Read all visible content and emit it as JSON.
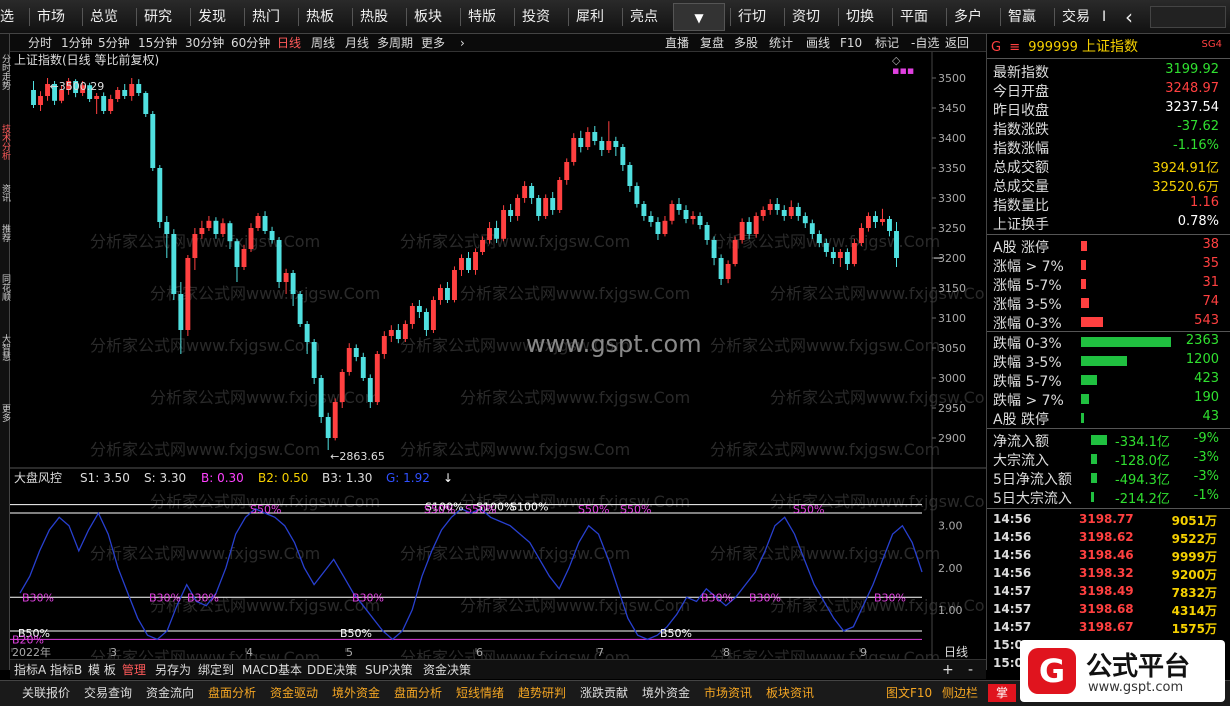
{
  "topmenu": {
    "items": [
      "选",
      "市场",
      "总览",
      "研究",
      "发现",
      "热门",
      "热板",
      "热股",
      "板块",
      "特版",
      "投资",
      "犀利",
      "亮点",
      "行切",
      "资切",
      "切换",
      "平面",
      "多户",
      "智赢",
      "交易",
      "I"
    ],
    "dropdown": "▼",
    "back": "‹"
  },
  "left_strip": [
    "分时走势",
    "技术分析",
    "资讯",
    "推荐",
    "同花顺",
    "大智慧",
    "更多"
  ],
  "subbar": {
    "periods": [
      "分时",
      "1分钟",
      "5分钟",
      "15分钟",
      "30分钟",
      "60分钟",
      "日线",
      "周线",
      "月线",
      "多周期",
      "更多"
    ],
    "active_index": 6,
    "tools": [
      "直播",
      "复盘",
      "多股",
      "统计",
      "画线",
      "F10",
      "标记",
      "-自选",
      "返回"
    ]
  },
  "chart": {
    "title": "上证指数(日线 等比前复权)",
    "watermark": "www.gspt.com",
    "bg_watermark": "分析家公式网www.fxjgsw.Com",
    "price_axis": [
      "3500",
      "3450",
      "3400",
      "3350",
      "3300",
      "3250",
      "3200",
      "3150",
      "3100",
      "3050",
      "3000",
      "2950",
      "2900"
    ],
    "annot_high": "3500.29",
    "annot_low": "2863.65",
    "indicator": {
      "name": "大盘风控",
      "params": [
        {
          "label": "S1: 3.50",
          "color": "#dddddd"
        },
        {
          "label": "S: 3.30",
          "color": "#dddddd"
        },
        {
          "label": "B: 0.30",
          "color": "#ff40ff"
        },
        {
          "label": "B2: 0.50",
          "color": "#f5d000"
        },
        {
          "label": "B3: 1.30",
          "color": "#dddddd"
        },
        {
          "label": "G: 1.92",
          "color": "#3050ff"
        }
      ],
      "axis": [
        "3.00",
        "2.00",
        "1.00"
      ],
      "marks_white": [
        "S100%",
        "S100%",
        "S100%",
        "B50%",
        "B50%",
        "B50%"
      ],
      "marks_magenta": [
        "S50%",
        "S50%",
        "S50%",
        "S50%",
        "S50%",
        "S50%",
        "B30%",
        "B30%",
        "B30%",
        "B30%",
        "B30%",
        "B30%",
        "B30%",
        "B20%"
      ]
    },
    "months": [
      "2022年",
      "3",
      "4",
      "5",
      "6",
      "7",
      "8",
      "9"
    ],
    "period_label": "日线",
    "zoom_in": "+",
    "zoom_out": "-"
  },
  "chart_data": {
    "type": "candlestick",
    "title": "上证指数(日线 等比前复权)",
    "ylim": [
      2880,
      3520
    ],
    "candles": [
      [
        3480,
        3455,
        3495,
        3450
      ],
      [
        3455,
        3470,
        3478,
        3445
      ],
      [
        3470,
        3490,
        3500,
        3462
      ],
      [
        3490,
        3462,
        3495,
        3455
      ],
      [
        3462,
        3480,
        3488,
        3458
      ],
      [
        3480,
        3495,
        3500,
        3472
      ],
      [
        3495,
        3475,
        3498,
        3468
      ],
      [
        3475,
        3488,
        3495,
        3470
      ],
      [
        3488,
        3465,
        3492,
        3460
      ],
      [
        3465,
        3470,
        3475,
        3440
      ],
      [
        3470,
        3445,
        3476,
        3440
      ],
      [
        3445,
        3465,
        3472,
        3440
      ],
      [
        3465,
        3480,
        3485,
        3460
      ],
      [
        3480,
        3470,
        3490,
        3465
      ],
      [
        3470,
        3490,
        3500,
        3462
      ],
      [
        3490,
        3475,
        3498,
        3470
      ],
      [
        3475,
        3440,
        3478,
        3435
      ],
      [
        3440,
        3350,
        3445,
        3345
      ],
      [
        3350,
        3260,
        3355,
        3250
      ],
      [
        3260,
        3240,
        3270,
        3200
      ],
      [
        3240,
        3140,
        3248,
        3130
      ],
      [
        3140,
        3080,
        3160,
        3040
      ],
      [
        3080,
        3200,
        3205,
        3070
      ],
      [
        3200,
        3240,
        3250,
        3180
      ],
      [
        3240,
        3250,
        3262,
        3232
      ],
      [
        3250,
        3262,
        3270,
        3245
      ],
      [
        3262,
        3240,
        3268,
        3232
      ],
      [
        3240,
        3258,
        3266,
        3235
      ],
      [
        3258,
        3228,
        3262,
        3215
      ],
      [
        3228,
        3185,
        3232,
        3160
      ],
      [
        3185,
        3215,
        3222,
        3180
      ],
      [
        3215,
        3250,
        3258,
        3210
      ],
      [
        3250,
        3270,
        3275,
        3245
      ],
      [
        3270,
        3245,
        3278,
        3240
      ],
      [
        3245,
        3230,
        3252,
        3224
      ],
      [
        3230,
        3160,
        3235,
        3150
      ],
      [
        3160,
        3175,
        3182,
        3140
      ],
      [
        3175,
        3140,
        3180,
        3120
      ],
      [
        3140,
        3090,
        3145,
        3085
      ],
      [
        3090,
        3060,
        3095,
        3040
      ],
      [
        3060,
        3000,
        3065,
        2990
      ],
      [
        3000,
        2935,
        3005,
        2925
      ],
      [
        2935,
        2900,
        2942,
        2880
      ],
      [
        2900,
        2960,
        2966,
        2896
      ],
      [
        2960,
        3010,
        3015,
        2950
      ],
      [
        3010,
        3050,
        3058,
        3004
      ],
      [
        3050,
        3035,
        3056,
        3028
      ],
      [
        3035,
        3000,
        3042,
        2995
      ],
      [
        3000,
        2960,
        3006,
        2950
      ],
      [
        2960,
        3040,
        3045,
        2955
      ],
      [
        3040,
        3070,
        3078,
        3032
      ],
      [
        3070,
        3080,
        3088,
        3060
      ],
      [
        3080,
        3065,
        3090,
        3058
      ],
      [
        3065,
        3090,
        3096,
        3060
      ],
      [
        3090,
        3120,
        3125,
        3082
      ],
      [
        3120,
        3110,
        3130,
        3100
      ],
      [
        3110,
        3080,
        3116,
        3070
      ],
      [
        3080,
        3130,
        3136,
        3075
      ],
      [
        3130,
        3150,
        3156,
        3122
      ],
      [
        3150,
        3130,
        3160,
        3125
      ],
      [
        3130,
        3180,
        3186,
        3126
      ],
      [
        3180,
        3200,
        3206,
        3170
      ],
      [
        3200,
        3180,
        3210,
        3175
      ],
      [
        3180,
        3210,
        3216,
        3172
      ],
      [
        3210,
        3230,
        3236,
        3205
      ],
      [
        3230,
        3250,
        3260,
        3224
      ],
      [
        3250,
        3232,
        3262,
        3225
      ],
      [
        3232,
        3280,
        3288,
        3228
      ],
      [
        3280,
        3270,
        3290,
        3260
      ],
      [
        3270,
        3300,
        3306,
        3262
      ],
      [
        3300,
        3320,
        3328,
        3292
      ],
      [
        3320,
        3300,
        3325,
        3290
      ],
      [
        3300,
        3270,
        3305,
        3262
      ],
      [
        3270,
        3300,
        3306,
        3265
      ],
      [
        3300,
        3280,
        3310,
        3272
      ],
      [
        3280,
        3330,
        3335,
        3275
      ],
      [
        3330,
        3360,
        3366,
        3322
      ],
      [
        3360,
        3400,
        3408,
        3354
      ],
      [
        3400,
        3385,
        3412,
        3376
      ],
      [
        3385,
        3410,
        3418,
        3380
      ],
      [
        3410,
        3395,
        3420,
        3388
      ],
      [
        3395,
        3380,
        3402,
        3370
      ],
      [
        3380,
        3395,
        3428,
        3375
      ],
      [
        3395,
        3385,
        3402,
        3370
      ],
      [
        3385,
        3355,
        3390,
        3345
      ],
      [
        3355,
        3320,
        3360,
        3310
      ],
      [
        3320,
        3290,
        3326,
        3284
      ],
      [
        3290,
        3270,
        3295,
        3262
      ],
      [
        3270,
        3260,
        3278,
        3252
      ],
      [
        3260,
        3240,
        3268,
        3230
      ],
      [
        3240,
        3262,
        3270,
        3236
      ],
      [
        3262,
        3290,
        3296,
        3256
      ],
      [
        3290,
        3280,
        3300,
        3272
      ],
      [
        3280,
        3265,
        3288,
        3258
      ],
      [
        3265,
        3270,
        3278,
        3256
      ],
      [
        3270,
        3255,
        3276,
        3248
      ],
      [
        3255,
        3230,
        3260,
        3222
      ],
      [
        3230,
        3200,
        3236,
        3188
      ],
      [
        3200,
        3165,
        3206,
        3155
      ],
      [
        3165,
        3190,
        3196,
        3158
      ],
      [
        3190,
        3230,
        3236,
        3186
      ],
      [
        3230,
        3260,
        3266,
        3224
      ],
      [
        3260,
        3240,
        3268,
        3232
      ],
      [
        3240,
        3270,
        3276,
        3234
      ],
      [
        3270,
        3280,
        3286,
        3262
      ],
      [
        3280,
        3290,
        3298,
        3272
      ],
      [
        3290,
        3280,
        3300,
        3272
      ],
      [
        3280,
        3270,
        3288,
        3262
      ],
      [
        3270,
        3285,
        3296,
        3265
      ],
      [
        3285,
        3270,
        3292,
        3262
      ],
      [
        3270,
        3258,
        3276,
        3250
      ],
      [
        3258,
        3240,
        3264,
        3232
      ],
      [
        3240,
        3225,
        3246,
        3218
      ],
      [
        3225,
        3210,
        3232,
        3202
      ],
      [
        3210,
        3200,
        3218,
        3190
      ],
      [
        3200,
        3210,
        3215,
        3185
      ],
      [
        3210,
        3190,
        3216,
        3180
      ],
      [
        3190,
        3225,
        3232,
        3186
      ],
      [
        3225,
        3250,
        3258,
        3220
      ],
      [
        3250,
        3270,
        3276,
        3244
      ],
      [
        3270,
        3260,
        3278,
        3250
      ],
      [
        3260,
        3265,
        3282,
        3254
      ],
      [
        3265,
        3245,
        3270,
        3236
      ],
      [
        3245,
        3200,
        3260,
        3185
      ]
    ]
  },
  "right_panel": {
    "code_prefix": "G",
    "menu_icon": "≡",
    "code": "999999",
    "name": "上证指数",
    "tag": "SG4",
    "quote": [
      {
        "label": "最新指数",
        "value": "3199.92",
        "cls": "dn"
      },
      {
        "label": "今日开盘",
        "value": "3248.97",
        "cls": "up"
      },
      {
        "label": "昨日收盘",
        "value": "3237.54",
        "cls": "wh"
      },
      {
        "label": "指数涨跌",
        "value": "-37.62",
        "cls": "dn"
      },
      {
        "label": "指数涨幅",
        "value": "-1.16%",
        "cls": "dn"
      },
      {
        "label": "总成交额",
        "value": "3924.91亿",
        "cls": "yl"
      },
      {
        "label": "总成交量",
        "value": "32520.6万",
        "cls": "yl"
      },
      {
        "label": "指数量比",
        "value": "1.16",
        "cls": "up"
      },
      {
        "label": "上证换手",
        "value": "0.78%",
        "cls": "wh"
      }
    ],
    "up_dist": [
      {
        "label": "A股 涨停",
        "value": "38",
        "bar": 6
      },
      {
        "label": "涨幅 > 7%",
        "value": "35",
        "bar": 5
      },
      {
        "label": "涨幅 5-7%",
        "value": "31",
        "bar": 5
      },
      {
        "label": "涨幅 3-5%",
        "value": "74",
        "bar": 8
      },
      {
        "label": "涨幅 0-3%",
        "value": "543",
        "bar": 22
      }
    ],
    "down_dist": [
      {
        "label": "跌幅 0-3%",
        "value": "2363",
        "bar": 90
      },
      {
        "label": "跌幅 3-5%",
        "value": "1200",
        "bar": 46
      },
      {
        "label": "跌幅 5-7%",
        "value": "423",
        "bar": 16
      },
      {
        "label": "跌幅 > 7%",
        "value": "190",
        "bar": 8
      },
      {
        "label": "A股 跌停",
        "value": "43",
        "bar": 3
      }
    ],
    "flows": [
      {
        "label": "净流入额",
        "value": "-334.1亿",
        "pct": "-9%",
        "bar": 16
      },
      {
        "label": "大宗流入",
        "value": "-128.0亿",
        "pct": "-3%",
        "bar": 6
      },
      {
        "label": "5日净流入额",
        "value": "-494.3亿",
        "pct": "-3%",
        "bar": 6
      },
      {
        "label": "5日大宗流入",
        "value": "-214.2亿",
        "pct": "-1%",
        "bar": 3
      }
    ],
    "ticks": [
      {
        "t": "14:56",
        "p": "3198.77",
        "v": "9051万"
      },
      {
        "t": "14:56",
        "p": "3198.62",
        "v": "9522万"
      },
      {
        "t": "14:56",
        "p": "3198.46",
        "v": "9999万"
      },
      {
        "t": "14:56",
        "p": "3198.32",
        "v": "9200万"
      },
      {
        "t": "14:57",
        "p": "3198.49",
        "v": "7832万"
      },
      {
        "t": "14:57",
        "p": "3198.68",
        "v": "4314万"
      },
      {
        "t": "14:57",
        "p": "3198.67",
        "v": "1575万"
      },
      {
        "t": "15:00",
        "p": "",
        "v": ""
      },
      {
        "t": "15:00",
        "p": "",
        "v": ""
      }
    ]
  },
  "bottom_tabs": [
    "指标A",
    "指标B",
    "模 板",
    "管理",
    "另存为",
    "绑定到",
    "MACD基本",
    "DDE决策",
    "SUP决策",
    "资金决策"
  ],
  "bottom_tabs_active": 3,
  "footer_tabs": [
    {
      "label": "关联报价",
      "hl": false
    },
    {
      "label": "交易查询",
      "hl": false
    },
    {
      "label": "资金流向",
      "hl": false
    },
    {
      "label": "盘面分析",
      "hl": true
    },
    {
      "label": "资金驱动",
      "hl": true
    },
    {
      "label": "境外资金",
      "hl": true
    },
    {
      "label": "盘面分析",
      "hl": true
    },
    {
      "label": "短线情绪",
      "hl": true
    },
    {
      "label": "趋势研判",
      "hl": true
    },
    {
      "label": "涨跌贡献",
      "hl": false
    },
    {
      "label": "境外资金",
      "hl": false
    },
    {
      "label": "市场资讯",
      "hl": true
    },
    {
      "label": "板块资讯",
      "hl": true
    }
  ],
  "footer_right": [
    "图文F10",
    "侧边栏"
  ],
  "footer_badge": "掌",
  "logo": {
    "mark": "G",
    "title": "公式平台",
    "url": "www.gspt.com"
  },
  "colors": {
    "up": "#ff4040",
    "down": "#50e0e0",
    "accent": "#ff5a5a",
    "indicator_line": "#2840d0"
  }
}
